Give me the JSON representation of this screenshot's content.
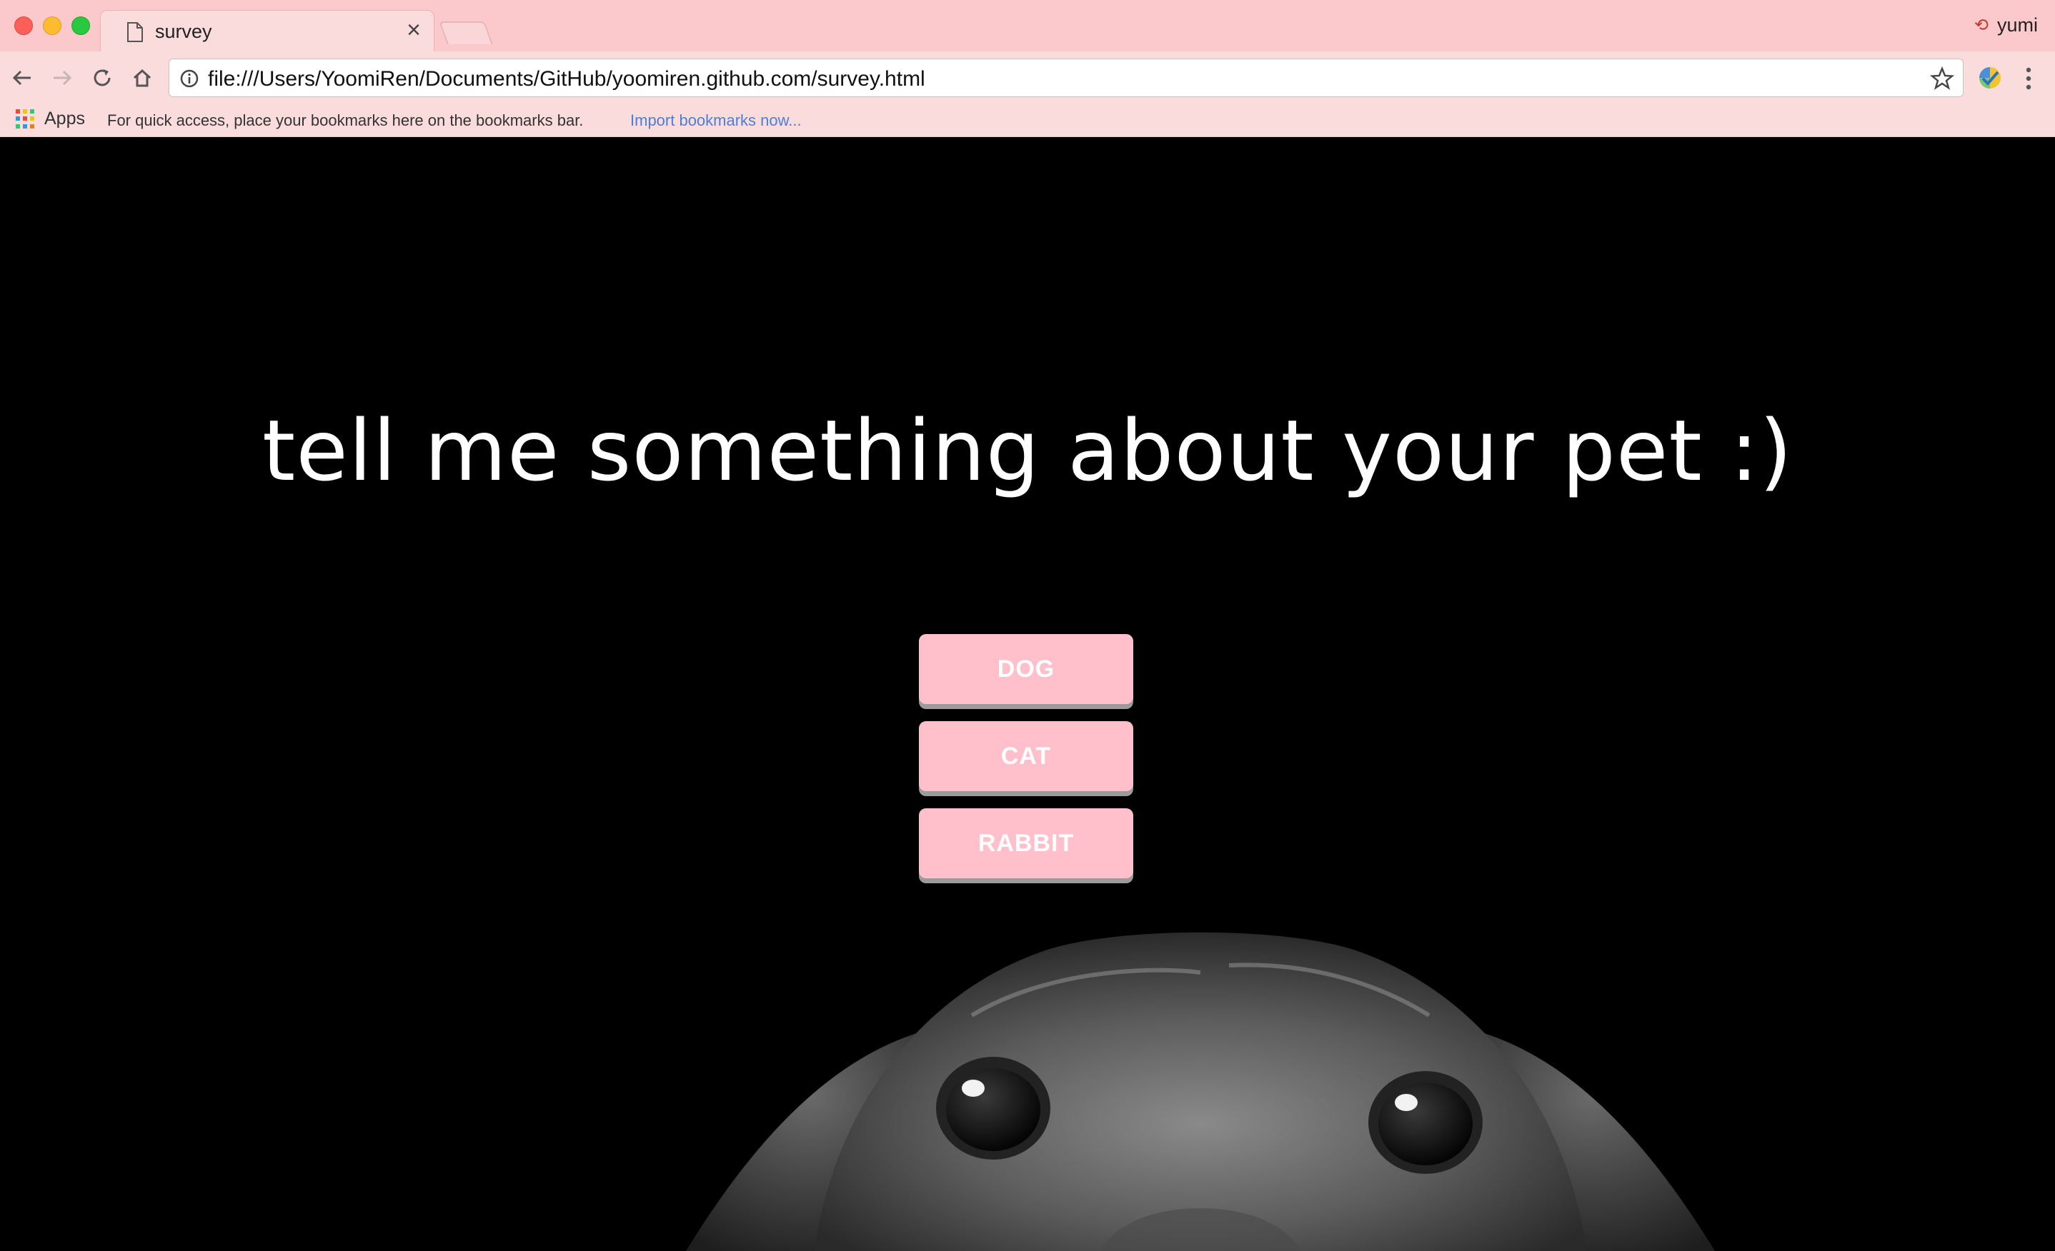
{
  "tab": {
    "title": "survey"
  },
  "profile": {
    "name": "yumi"
  },
  "address_bar": {
    "url": "file:///Users/YoomiRen/Documents/GitHub/yoomiren.github.com/survey.html"
  },
  "bookmarks_bar": {
    "apps_label": "Apps",
    "hint": "For quick access, place your bookmarks here on the bookmarks bar.",
    "import_link": "Import bookmarks now..."
  },
  "page": {
    "heading": "tell me something about your pet :)",
    "options": [
      "DOG",
      "CAT",
      "RABBIT"
    ]
  },
  "colors": {
    "chrome_titlebar": "#fbc8cb",
    "chrome_toolbar": "#fbdcdc",
    "page_background": "#000000",
    "button_background": "#ffc0cb",
    "button_text": "#ffffff",
    "link": "#4a7fd6"
  },
  "icons": [
    "page-icon",
    "close-icon",
    "back-arrow-icon",
    "forward-arrow-icon",
    "reload-icon",
    "home-icon",
    "info-icon",
    "star-icon",
    "extension-icon",
    "menu-dots-icon",
    "apps-grid-icon",
    "sync-icon"
  ]
}
